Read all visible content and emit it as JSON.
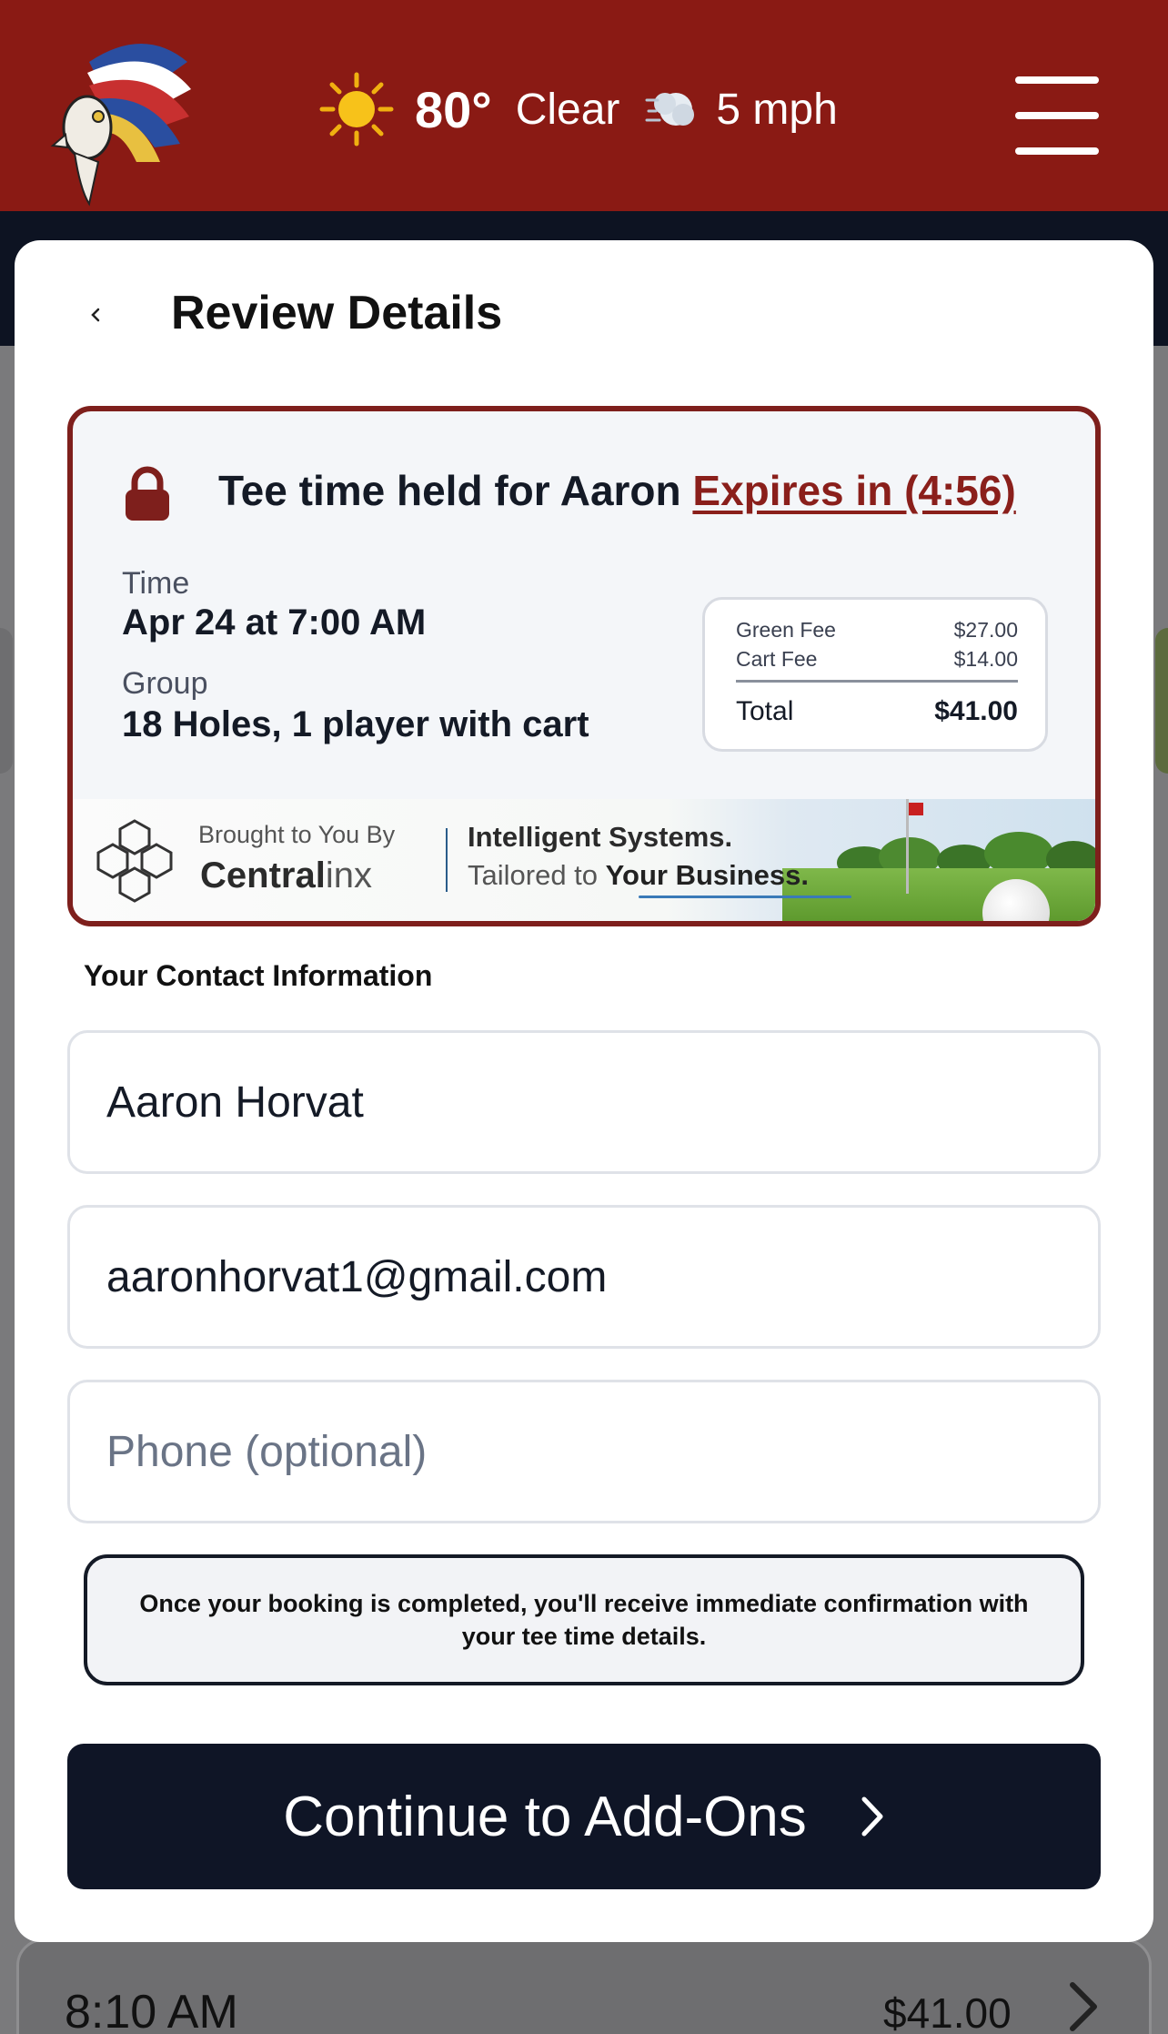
{
  "header": {
    "logo_icon": "chief-headdress-logo",
    "weather": {
      "icon": "sun-icon",
      "temperature": "80°",
      "condition": "Clear",
      "wind_icon": "wind-icon",
      "wind": "5 mph"
    },
    "menu_icon": "hamburger-menu-icon",
    "color": "#8a1a14"
  },
  "modal": {
    "title": "Review Details",
    "hold": {
      "prefix": "Tee time held for Aaron ",
      "expires": "Expires in (4:56)",
      "time_label": "Time",
      "time_value": "Apr 24 at 7:00 AM",
      "group_label": "Group",
      "group_value": "18 Holes, 1 player with cart",
      "fees": [
        {
          "label": "Green Fee",
          "amount": "$27.00"
        },
        {
          "label": "Cart Fee",
          "amount": "$14.00"
        }
      ],
      "total_label": "Total",
      "total_amount": "$41.00",
      "accent": "#7e1f1c"
    },
    "sponsor": {
      "brought_by": "Brought to You By",
      "brand_bold": "Central",
      "brand_light": "inx",
      "line1": "Intelligent Systems.",
      "line2_prefix": "Tailored to ",
      "line2_bold": "Your Business."
    },
    "contact": {
      "label": "Your Contact Information",
      "name_value": "Aaron Horvat",
      "email_value": "aaronhorvat1@gmail.com",
      "phone_placeholder": "Phone (optional)"
    },
    "notice": "Once your booking is completed, you'll receive immediate confirmation with your tee time details.",
    "cta_label": "Continue to Add-Ons"
  },
  "peek_row": {
    "time": "8:10 AM",
    "price": "$41.00"
  }
}
